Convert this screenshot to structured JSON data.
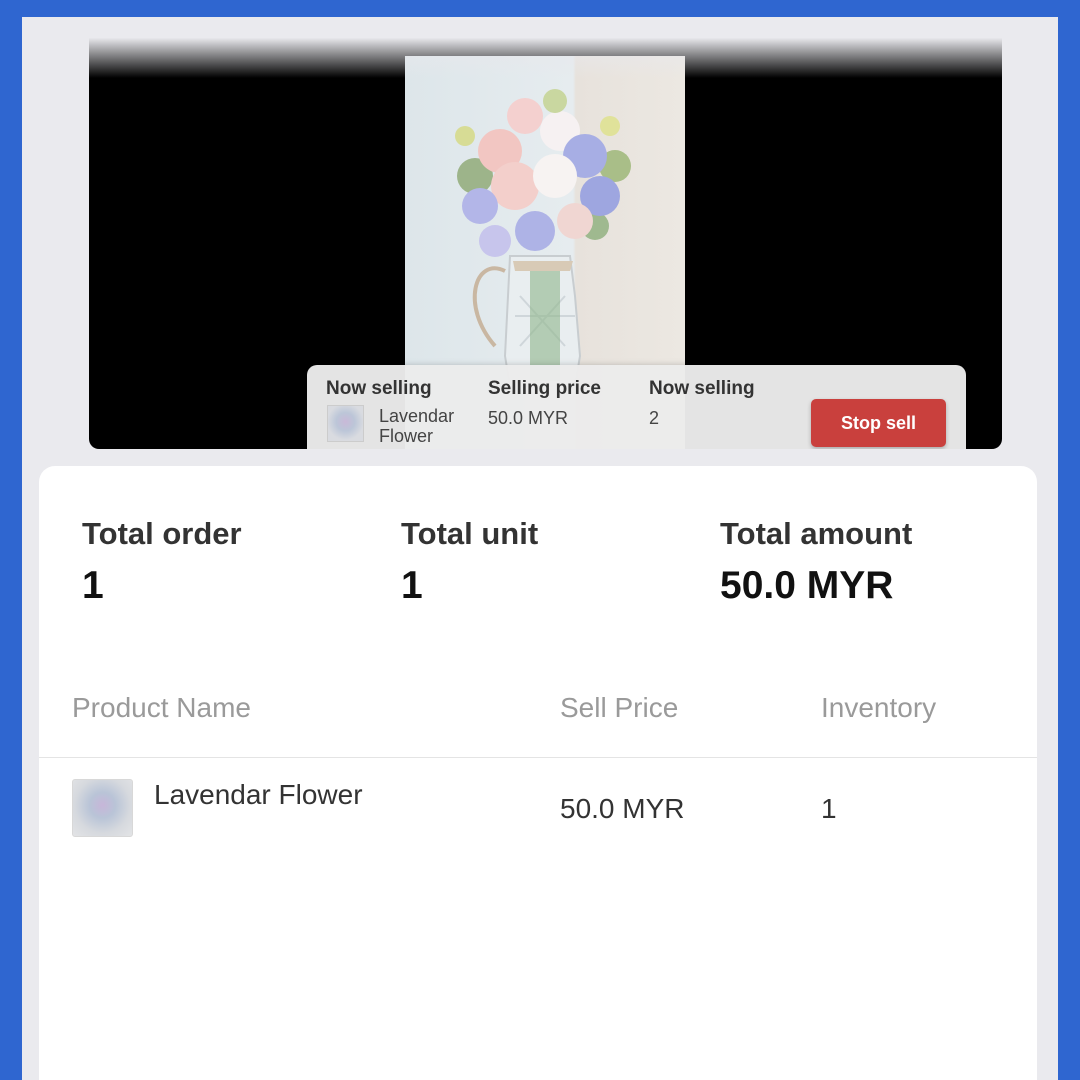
{
  "sell_bar": {
    "now_selling_label": "Now selling",
    "product_name": "Lavendar Flower",
    "selling_price_label": "Selling price",
    "selling_price": "50.0 MYR",
    "now_selling_count_label": "Now selling",
    "now_selling_count": "2",
    "stop_button": "Stop sell"
  },
  "stats": [
    {
      "label": "Total order",
      "value": "1"
    },
    {
      "label": "Total unit",
      "value": "1"
    },
    {
      "label": "Total amount",
      "value": "50.0 MYR"
    }
  ],
  "table": {
    "headers": [
      "Product Name",
      "Sell Price",
      "Inventory"
    ],
    "rows": [
      {
        "name": "Lavendar Flower",
        "price": "50.0 MYR",
        "inventory": "1"
      }
    ]
  },
  "colors": {
    "background": "#2f66d0",
    "stop_button": "#c9403d"
  }
}
